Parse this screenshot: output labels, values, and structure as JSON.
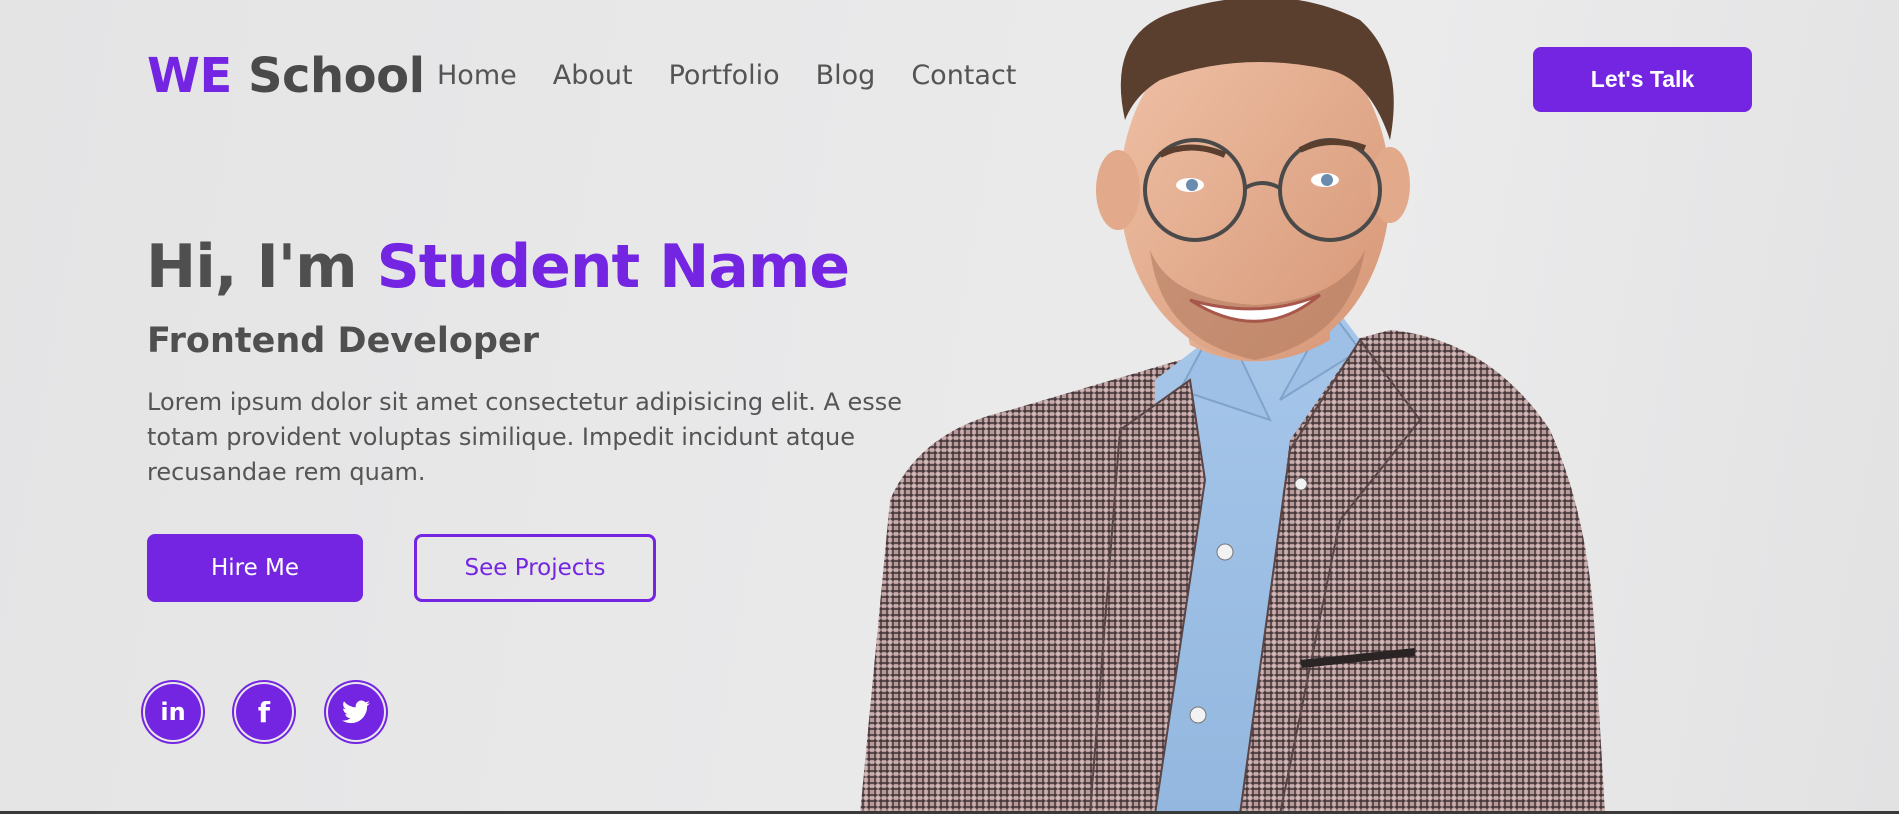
{
  "header": {
    "logo_accent": "WE",
    "logo_rest": "School",
    "nav": [
      "Home",
      "About",
      "Portfolio",
      "Blog",
      "Contact"
    ],
    "cta_label": "Let's Talk"
  },
  "hero": {
    "greeting_prefix": "Hi, I'm ",
    "name": "Student Name",
    "role": "Frontend Developer",
    "description": "Lorem ipsum dolor sit amet consectetur adipisicing elit. A esse totam provident voluptas similique. Impedit incidunt atque recusandae rem quam.",
    "hire_label": "Hire Me",
    "projects_label": "See Projects"
  },
  "social": [
    {
      "icon": "linkedin-icon",
      "glyph": "in"
    },
    {
      "icon": "facebook-icon",
      "glyph": "f"
    },
    {
      "icon": "twitter-icon",
      "glyph": "bird"
    }
  ],
  "colors": {
    "accent": "#7325e2",
    "text": "#4f4f4f",
    "background": "#e8e8e9"
  }
}
